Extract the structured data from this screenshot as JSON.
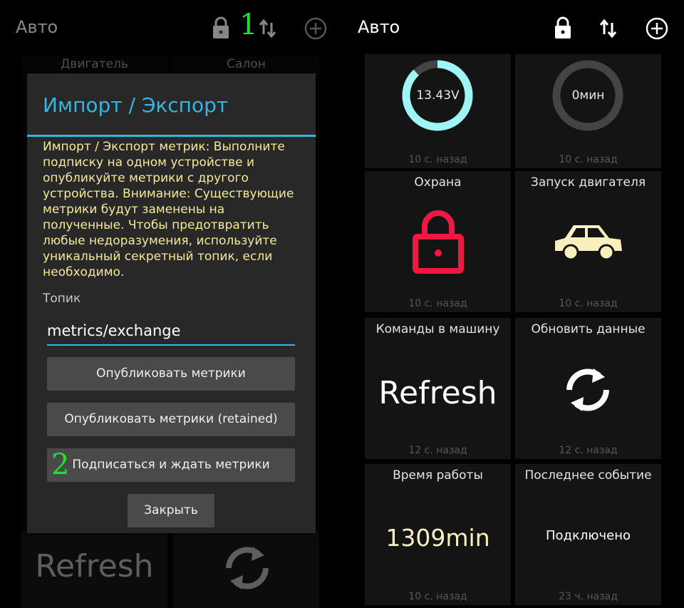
{
  "app": {
    "title": "Авто"
  },
  "left": {
    "marker_top": "1",
    "marker_button": "2",
    "bg_tiles": {
      "engine": "Двигатель",
      "salon": "Салон",
      "refresh": "Refresh"
    },
    "dialog": {
      "title": "Импорт / Экспорт",
      "message": "Импорт / Экспорт метрик: Выполните подписку на одном устройстве и опубликуйте метрики с другого устройства. Внимание: Существующие метрики будут заменены на полученные. Чтобы предотвратить любые недоразумения, используйте уникальный секретный топик, если необходимо.",
      "topic_label": "Топик",
      "topic_value": "metrics/exchange",
      "publish_label": "Опубликовать метрики",
      "publish_retained_label": "Опубликовать метрики (retained)",
      "subscribe_label": "Подписаться и ждать метрики",
      "close_label": "Закрыть"
    }
  },
  "right": {
    "tiles": {
      "voltage": {
        "title": "",
        "value": "13.43V",
        "time": "10 с. назад",
        "ring_fill": 0.88
      },
      "minutes": {
        "title": "",
        "value": "0мин",
        "time": "10 с. назад",
        "ring_fill": 0
      },
      "guard": {
        "title": "Охрана",
        "time": "10 с. назад"
      },
      "engine_start": {
        "title": "Запуск двигателя",
        "time": "10 с. назад"
      },
      "commands": {
        "title": "Команды в машину",
        "value": "Refresh",
        "time": "12 с. назад"
      },
      "update": {
        "title": "Обновить данные",
        "time": "12 с. назад"
      },
      "uptime": {
        "title": "Время работы",
        "value": "1309min",
        "time": "10 с. назад"
      },
      "last_event": {
        "title": "Последнее событие",
        "value": "Подключено",
        "time": "23 ч. назад"
      }
    }
  },
  "colors": {
    "accent": "#33b5e5",
    "ring": "#9ff5f5",
    "lock": "#f01843",
    "car": "#f9efbf",
    "marker": "#19e52b"
  },
  "icons": [
    "lock-icon",
    "swap-vert-icon",
    "add-circle-icon",
    "car-icon",
    "refresh-icon"
  ]
}
